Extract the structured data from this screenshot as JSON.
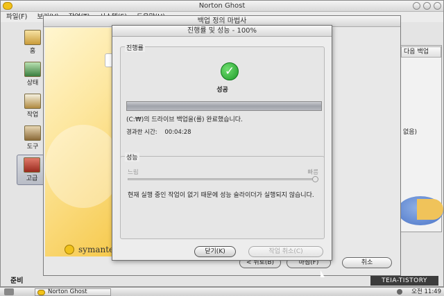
{
  "main_window": {
    "title": "Norton Ghost",
    "menu": [
      "파일(F)",
      "보기(V)",
      "작업(T)",
      "시스템(S)",
      "도움말(H)"
    ]
  },
  "nav": [
    {
      "label": "홈",
      "icon": "home-icon"
    },
    {
      "label": "상태",
      "icon": "status-chart-icon"
    },
    {
      "label": "작업",
      "icon": "tasks-clipboard-icon"
    },
    {
      "label": "도구",
      "icon": "tools-icon"
    },
    {
      "label": "고급",
      "icon": "advanced-icon"
    }
  ],
  "right_panel": {
    "header": "다음 백업",
    "partial_text": "없음)"
  },
  "status_bar": "준비",
  "wizard": {
    "title": "백업 정의 마법사",
    "brand": "symantec",
    "buttons": {
      "back": "< 뒤로(B)",
      "next": "마침(F)",
      "cancel": "취소"
    }
  },
  "progress_dialog": {
    "title": "진행률 및 성능 - 100%",
    "progress_group_label": "진행률",
    "status_label": "성공",
    "progress_percent": 100,
    "completed_message": "(C:₩)의 드라이브 백업을(를) 완료했습니다.",
    "elapsed_label": "경과한 시간:",
    "elapsed_value": "00:04:28",
    "performance_group_label": "성능",
    "slider_slow": "느림",
    "slider_fast": "빠름",
    "slider_level": 1.0,
    "performance_message": "현재 실행 중인 작업이 없기 때문에 성능 슬라이더가 실행되지 않습니다.",
    "close_button": "닫기(K)",
    "cancel_task_button": "작업 취소(C)"
  },
  "taskbar": {
    "app_button": "Norton Ghost",
    "clock": "오전 11:49",
    "watermark": "TEIA-TISTORY"
  },
  "colors": {
    "success_green": "#1e9a2a",
    "wizard_sidebar_yellow": "#f6c94c",
    "desktop": "#9fa6c9"
  }
}
